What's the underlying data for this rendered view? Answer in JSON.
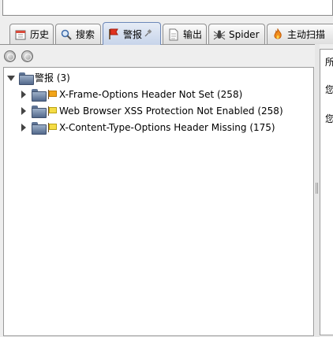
{
  "tabs": [
    {
      "id": "history",
      "label": "历史",
      "icon": "calendar-icon",
      "active": false
    },
    {
      "id": "search",
      "label": "搜索",
      "icon": "magnifier-icon",
      "active": false
    },
    {
      "id": "alerts",
      "label": "警报",
      "icon": "red-flag-icon",
      "active": true,
      "pinned": true
    },
    {
      "id": "output",
      "label": "输出",
      "icon": "document-icon",
      "active": false
    },
    {
      "id": "spider",
      "label": "Spider",
      "icon": "spider-icon",
      "active": false
    },
    {
      "id": "active-scan",
      "label": "主动扫描",
      "icon": "flame-icon",
      "active": false
    }
  ],
  "toolbar": {
    "buttons": [
      "filter-icon",
      "settings-icon"
    ]
  },
  "tree": {
    "root": {
      "label": "警报 (3)",
      "expanded": true
    },
    "items": [
      {
        "label": "X-Frame-Options Header Not Set (258)",
        "risk_flag": "orange-flag-icon",
        "risk_color": "#f2a51a"
      },
      {
        "label": "Web Browser XSS Protection Not Enabled (258)",
        "risk_flag": "yellow-flag-icon",
        "risk_color": "#f5dc45"
      },
      {
        "label": "X-Content-Type-Options Header Missing (175)",
        "risk_flag": "yellow-flag-icon",
        "risk_color": "#f5dc45"
      }
    ]
  },
  "detail": {
    "lines": [
      "所",
      "您",
      "您"
    ]
  }
}
